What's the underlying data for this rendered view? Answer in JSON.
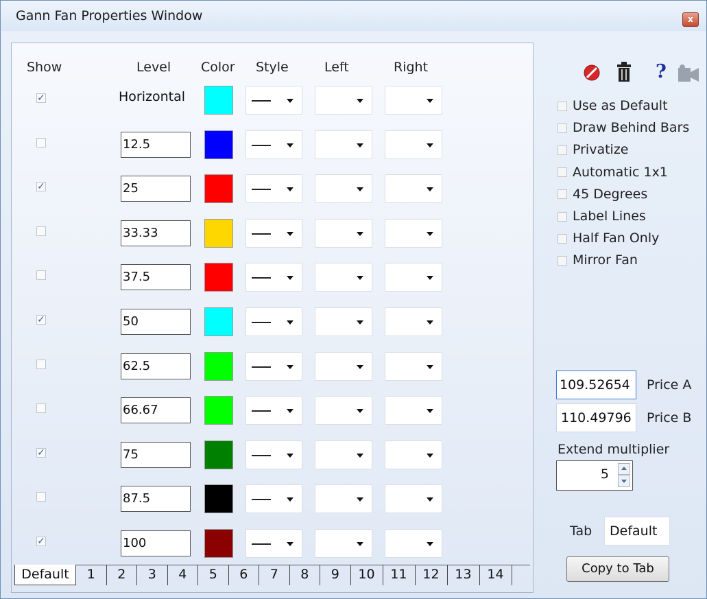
{
  "window": {
    "title": "Gann Fan Properties Window",
    "close_glyph": "x"
  },
  "headers": {
    "show": "Show",
    "level": "Level",
    "color": "Color",
    "style": "Style",
    "left": "Left",
    "right": "Right"
  },
  "rows": [
    {
      "checked": true,
      "level": "Horizontal",
      "editable": false,
      "color": "#00ffff"
    },
    {
      "checked": false,
      "level": "12.5",
      "editable": true,
      "color": "#0000ff"
    },
    {
      "checked": true,
      "level": "25",
      "editable": true,
      "color": "#ff0000"
    },
    {
      "checked": false,
      "level": "33.33",
      "editable": true,
      "color": "#ffd700"
    },
    {
      "checked": false,
      "level": "37.5",
      "editable": true,
      "color": "#ff0000"
    },
    {
      "checked": true,
      "level": "50",
      "editable": true,
      "color": "#00ffff"
    },
    {
      "checked": false,
      "level": "62.5",
      "editable": true,
      "color": "#00ff00"
    },
    {
      "checked": false,
      "level": "66.67",
      "editable": true,
      "color": "#00ff00"
    },
    {
      "checked": true,
      "level": "75",
      "editable": true,
      "color": "#008000"
    },
    {
      "checked": false,
      "level": "87.5",
      "editable": true,
      "color": "#000000"
    },
    {
      "checked": true,
      "level": "100",
      "editable": true,
      "color": "#8b0000"
    }
  ],
  "toolbar": {
    "icons": [
      "stop-icon",
      "trash-icon",
      "help-icon",
      "camera-icon"
    ],
    "help_glyph": "?"
  },
  "options": [
    "Use as Default",
    "Draw Behind Bars",
    "Privatize",
    "Automatic 1x1",
    "45 Degrees",
    "Label Lines",
    "Half Fan Only",
    "Mirror Fan"
  ],
  "price_a": {
    "value": "109.52654",
    "label": "Price A"
  },
  "price_b": {
    "value": "110.49796",
    "label": "Price B"
  },
  "extend": {
    "label": "Extend multiplier",
    "value": "5"
  },
  "tab_field": {
    "label": "Tab",
    "value": "Default"
  },
  "copy_button": "Copy to Tab",
  "tabs": [
    "Default",
    "1",
    "2",
    "3",
    "4",
    "5",
    "6",
    "7",
    "8",
    "9",
    "10",
    "11",
    "12",
    "13",
    "14"
  ],
  "colors": {
    "accent": "#4361a3",
    "close": "#c64a31"
  }
}
